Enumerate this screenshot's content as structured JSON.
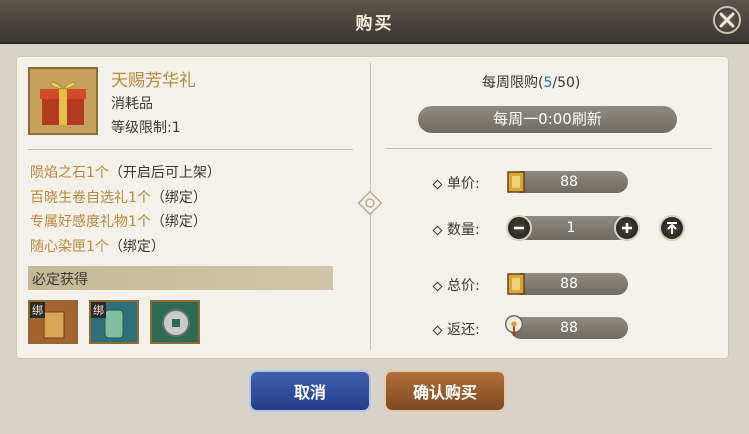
{
  "window": {
    "title": "购买"
  },
  "item": {
    "name": "天赐芳华礼",
    "type": "消耗品",
    "level_label": "等级限制:",
    "level_value": "1"
  },
  "rewards": [
    {
      "name": "陨焰之石1个",
      "note": "（开启后可上架）"
    },
    {
      "name": "百晓生卷自选礼1个",
      "note": "（绑定）"
    },
    {
      "name": "专属好感度礼物1个",
      "note": "（绑定）"
    },
    {
      "name": "随心染匣1个",
      "note": "（绑定）"
    }
  ],
  "must_get": {
    "label": "必定获得",
    "slots": [
      {
        "tag": "绑",
        "color": "#a5642f",
        "icon": "scroll-icon"
      },
      {
        "tag": "绑",
        "color": "#2f6f7a",
        "icon": "jade-token-icon"
      },
      {
        "tag": "",
        "color": "#2f6a55",
        "icon": "coin-icon"
      }
    ]
  },
  "purchase": {
    "weekly_label": "每周限购",
    "weekly_open": "(",
    "weekly_count": "5",
    "weekly_limit": "/50)",
    "refresh_text": "每周一0:00刷新",
    "unit_price_label": "单价:",
    "unit_price": "88",
    "quantity_label": "数量:",
    "quantity": "1",
    "total_label": "总价:",
    "total": "88",
    "rebate_label": "返还:",
    "rebate": "88"
  },
  "buttons": {
    "cancel": "取消",
    "confirm": "确认购买"
  }
}
